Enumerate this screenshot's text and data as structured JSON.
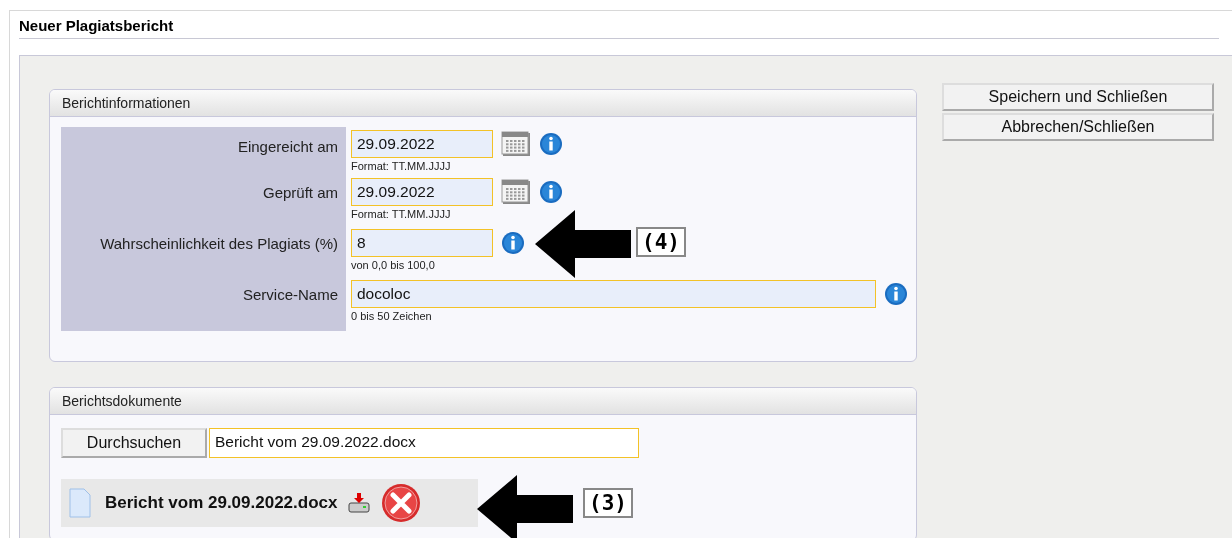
{
  "window": {
    "title": "Neuer Plagiatsbericht"
  },
  "report_info": {
    "title": "Berichtinformationen",
    "annotation": "(4)",
    "fields": [
      {
        "label": "Eingereicht am",
        "value": "29.09.2022",
        "hint": "Format: TT.MM.JJJJ",
        "kind": "date"
      },
      {
        "label": "Geprüft am",
        "value": "29.09.2022",
        "hint": "Format: TT.MM.JJJJ",
        "kind": "date"
      },
      {
        "label": "Wahrscheinlichkeit des Plagiats (%)",
        "value": "8",
        "hint": "von 0,0 bis 100,0",
        "kind": "short"
      },
      {
        "label": "Service-Name",
        "value": "docoloc",
        "hint": "0 bis 50 Zeichen",
        "kind": "wide"
      }
    ]
  },
  "documents": {
    "title": "Berichtsdokumente",
    "annotation": "(3)",
    "browse_button": "Durchsuchen",
    "file_field": "Bericht vom 29.09.2022.docx",
    "files": [
      {
        "name": "Bericht vom 29.09.2022.docx"
      }
    ]
  },
  "buttons": [
    "Speichern und Schließen",
    "Abbrechen/Schließen"
  ]
}
